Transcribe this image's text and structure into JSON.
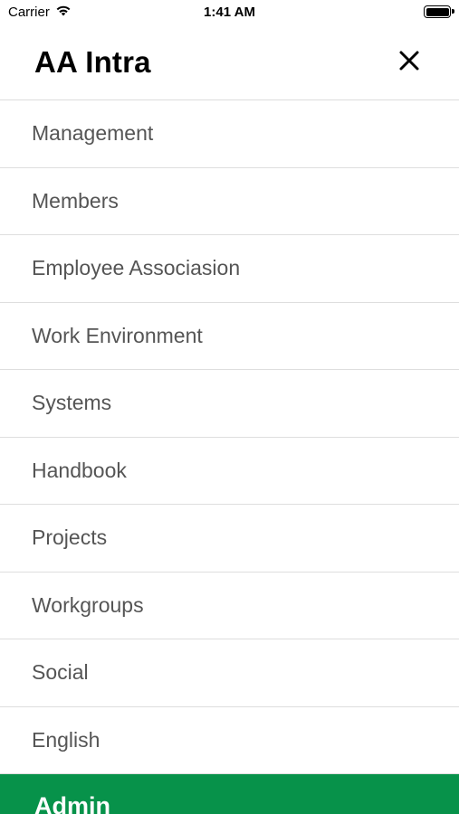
{
  "status_bar": {
    "carrier": "Carrier",
    "time": "1:41 AM",
    "wifi_icon": "wifi-icon",
    "battery_icon": "battery-icon"
  },
  "header": {
    "title": "AA Intra",
    "close_icon": "close-icon"
  },
  "menu": {
    "items": [
      {
        "label": "Management"
      },
      {
        "label": "Members"
      },
      {
        "label": "Employee Associasion"
      },
      {
        "label": "Work Environment"
      },
      {
        "label": "Systems"
      },
      {
        "label": "Handbook"
      },
      {
        "label": "Projects"
      },
      {
        "label": "Workgroups"
      },
      {
        "label": "Social"
      },
      {
        "label": "English"
      }
    ]
  },
  "footer": {
    "admin_label": "Admin",
    "accent_color": "#07924a"
  }
}
